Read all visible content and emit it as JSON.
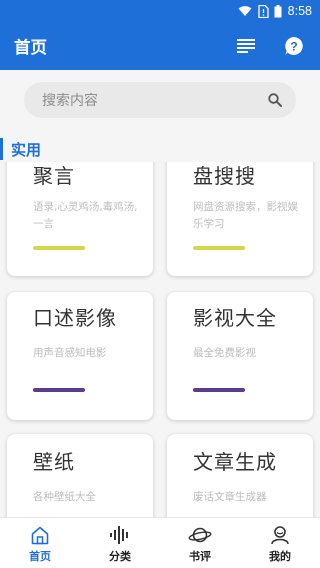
{
  "status_bar": {
    "time": "8:58",
    "icons": [
      "wifi-icon",
      "sim-no-signal-icon",
      "battery-icon"
    ]
  },
  "app_bar": {
    "title": "首页",
    "menu_icon": "list-icon",
    "help_icon": "help-icon"
  },
  "search": {
    "placeholder": "搜索内容",
    "icon": "search-icon"
  },
  "section": {
    "label": "实用"
  },
  "cards": [
    {
      "title": "聚言",
      "desc": "语录,心灵鸡汤,毒鸡汤,一言",
      "accent": "#d6d64a"
    },
    {
      "title": "盘搜搜",
      "desc": "网盘资源搜索，影视娱乐学习",
      "accent": "#d6d64a"
    },
    {
      "title": "口述影像",
      "desc": "用声音感知电影",
      "accent": "#5a3d8a"
    },
    {
      "title": "影视大全",
      "desc": "最全免费影视",
      "accent": "#5a3d8a"
    },
    {
      "title": "壁纸",
      "desc": "各种壁纸大全",
      "accent": ""
    },
    {
      "title": "文章生成",
      "desc": "废话文章生成器",
      "accent": ""
    }
  ],
  "bottom_nav": [
    {
      "label": "首页",
      "icon": "home-icon",
      "active": true
    },
    {
      "label": "分类",
      "icon": "soundwave-icon",
      "active": false
    },
    {
      "label": "书评",
      "icon": "planet-icon",
      "active": false
    },
    {
      "label": "我的",
      "icon": "user-icon",
      "active": false
    }
  ],
  "colors": {
    "primary": "#1f6fd8",
    "card_accent_yellow": "#d6d64a",
    "card_accent_purple": "#5a3d8a"
  }
}
